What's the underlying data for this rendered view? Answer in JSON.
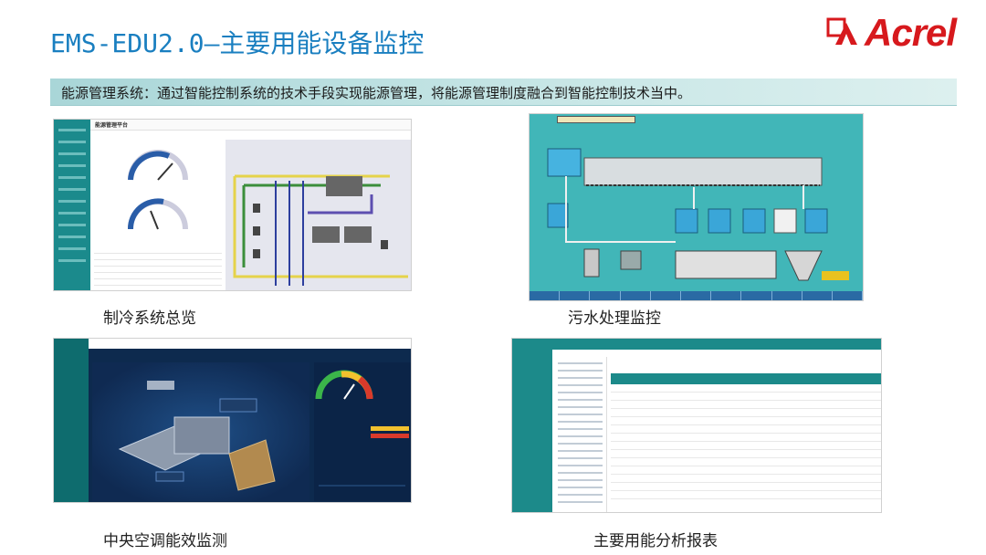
{
  "slide": {
    "title": "EMS-EDU2.0—主要用能设备监控",
    "subtitle": "能源管理系统：通过智能控制系统的技术手段实现能源管理，将能源管理制度融合到智能控制技术当中。",
    "logo_text": "Acrel"
  },
  "screenshots": [
    {
      "caption": "制冷系统总览",
      "header": "能源管理平台"
    },
    {
      "caption": "污水处理监控"
    },
    {
      "caption": "中央空调能效监测"
    },
    {
      "caption": "主要用能分析报表"
    }
  ],
  "colors": {
    "title": "#1a7fc0",
    "logo": "#d7191d",
    "banner": "#a9d6d8"
  }
}
